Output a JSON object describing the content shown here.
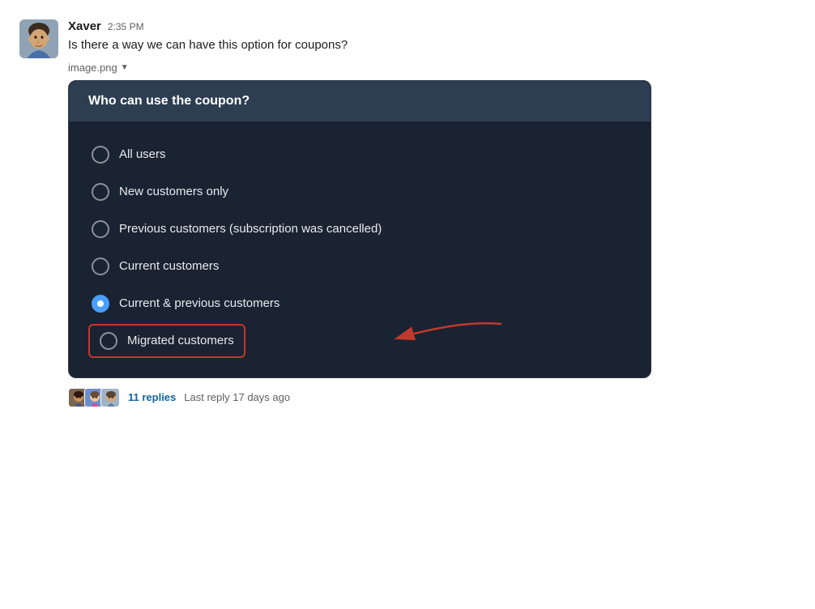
{
  "message": {
    "username": "Xaver",
    "timestamp": "2:35 PM",
    "text": "Is there a way we can have this option for coupons?",
    "attachment_label": "image.png"
  },
  "coupon_card": {
    "header_title": "Who can use the coupon?",
    "options": [
      {
        "id": "all-users",
        "label": "All users",
        "selected": false
      },
      {
        "id": "new-customers",
        "label": "New customers only",
        "selected": false
      },
      {
        "id": "previous-customers",
        "label": "Previous customers (subscription was cancelled)",
        "selected": false
      },
      {
        "id": "current-customers",
        "label": "Current customers",
        "selected": false
      },
      {
        "id": "current-previous",
        "label": "Current & previous customers",
        "selected": true
      },
      {
        "id": "migrated-customers",
        "label": "Migrated customers",
        "selected": false,
        "highlighted": true
      }
    ]
  },
  "replies": {
    "count_label": "11 replies",
    "meta": "Last reply 17 days ago"
  },
  "colors": {
    "highlight_border": "#c0392b",
    "arrow_color": "#c0392b",
    "selected_radio": "#4a9eff"
  }
}
